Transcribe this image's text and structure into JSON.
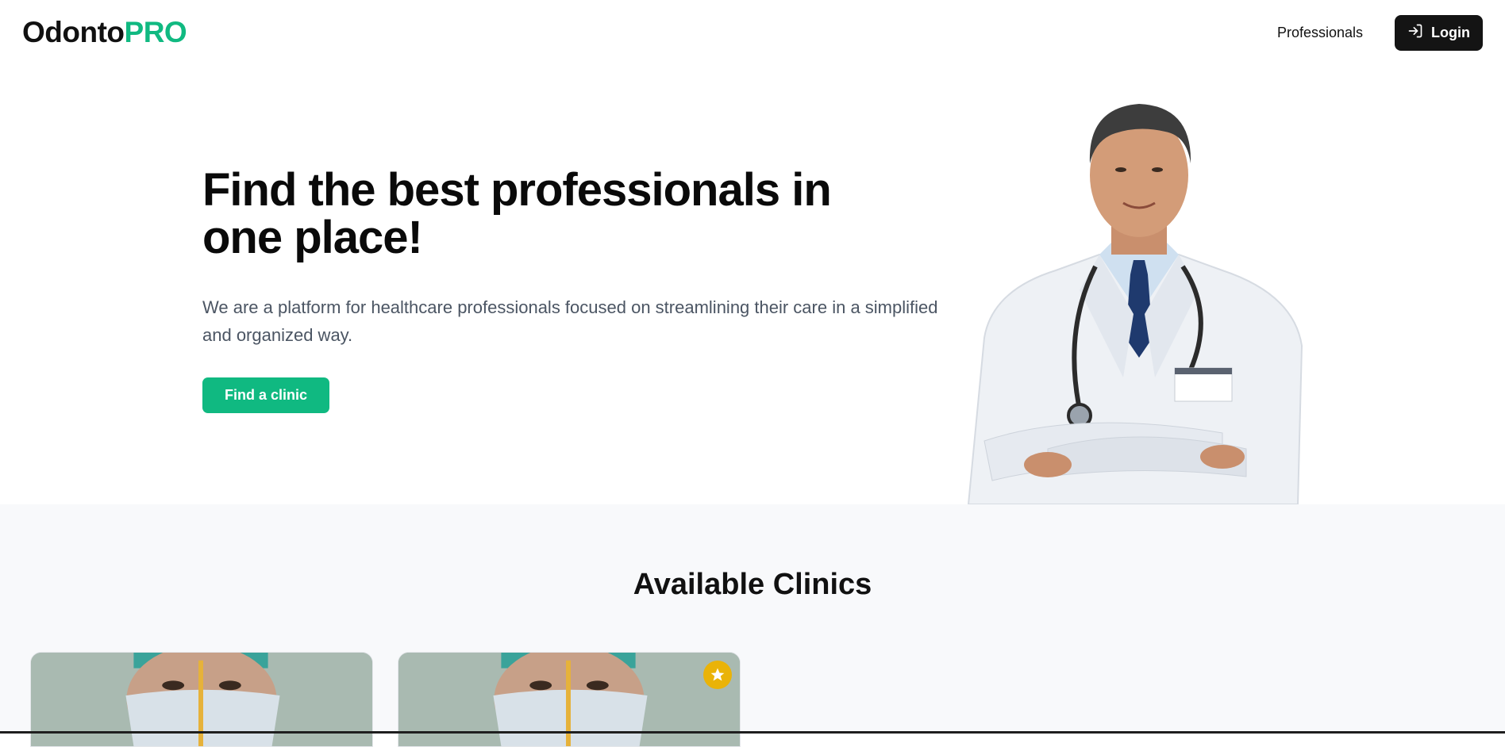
{
  "header": {
    "logo_main": "Odonto",
    "logo_accent": "PRO",
    "nav_professionals": "Professionals",
    "login_label": "Login"
  },
  "hero": {
    "title": "Find the best professionals in one place!",
    "subtitle": "We are a platform for healthcare professionals focused on streamlining their care in a simplified and organized way.",
    "cta_label": "Find a clinic"
  },
  "clinics": {
    "section_title": "Available Clinics",
    "cards": [
      {
        "featured": false
      },
      {
        "featured": true
      }
    ]
  },
  "colors": {
    "accent": "#10b981",
    "dark": "#141414",
    "badge": "#eab308",
    "section_bg": "#f8f9fb"
  }
}
